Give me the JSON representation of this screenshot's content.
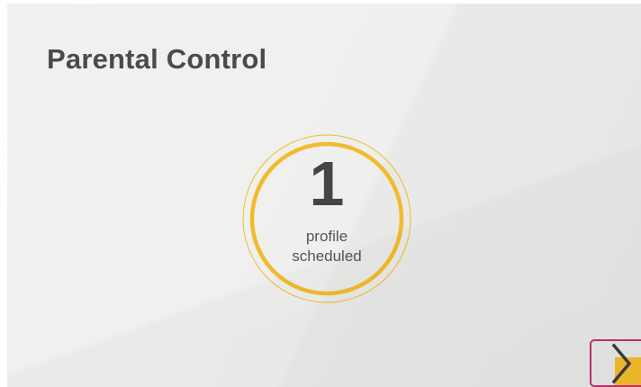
{
  "widget": {
    "title": "Parental Control",
    "count": "1",
    "label_line1": "profile",
    "label_line2": "scheduled"
  },
  "colors": {
    "accent": "#f2bb2b",
    "highlight_border": "#c0316e",
    "title_text": "#4a4a4a"
  },
  "icons": {
    "next": "chevron-right-icon"
  }
}
